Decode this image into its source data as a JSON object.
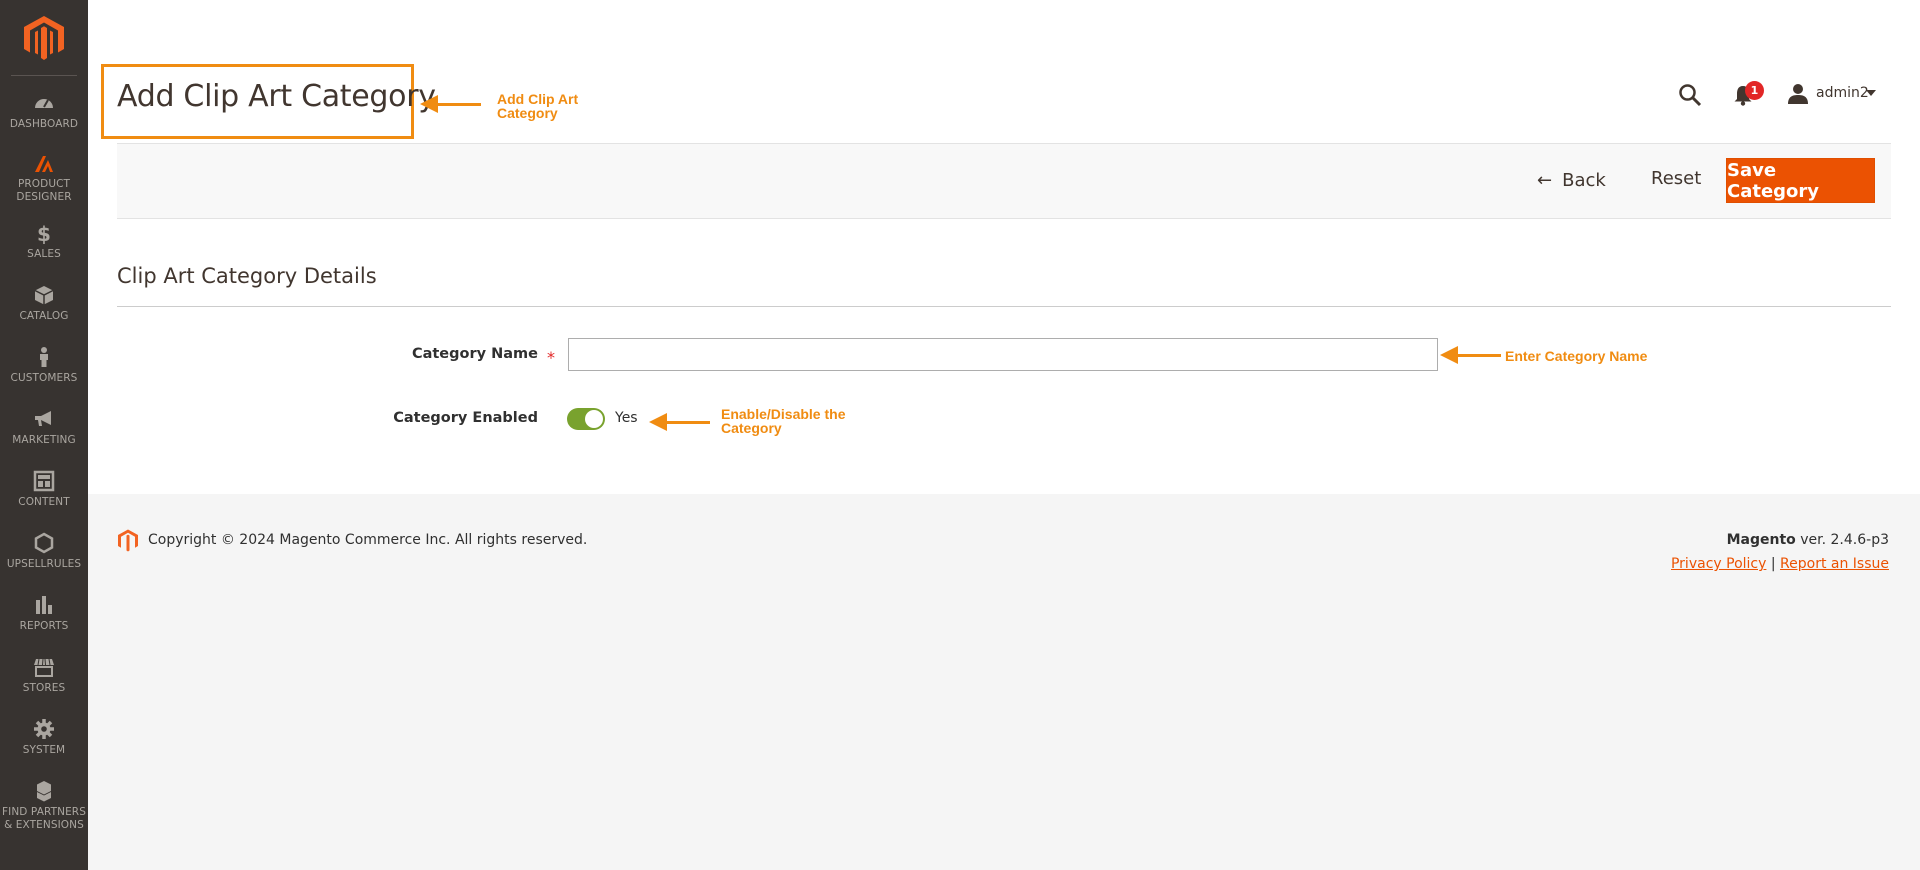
{
  "sidebar": {
    "logo": "magento-logo",
    "items": [
      {
        "label": "DASHBOARD",
        "icon": "dashboard-icon"
      },
      {
        "label": "PRODUCT DESIGNER",
        "icon": "product-designer-icon"
      },
      {
        "label": "SALES",
        "icon": "dollar-icon"
      },
      {
        "label": "CATALOG",
        "icon": "cube-icon"
      },
      {
        "label": "CUSTOMERS",
        "icon": "person-icon"
      },
      {
        "label": "MARKETING",
        "icon": "megaphone-icon"
      },
      {
        "label": "CONTENT",
        "icon": "layout-icon"
      },
      {
        "label": "UPSELLRULES",
        "icon": "hexagon-icon"
      },
      {
        "label": "REPORTS",
        "icon": "bar-chart-icon"
      },
      {
        "label": "STORES",
        "icon": "storefront-icon"
      },
      {
        "label": "SYSTEM",
        "icon": "gear-icon"
      },
      {
        "label": "FIND PARTNERS & EXTENSIONS",
        "icon": "boxes-icon"
      }
    ]
  },
  "header": {
    "title": "Add Clip Art Category",
    "notification_count": "1",
    "user_name": "admin2"
  },
  "annotations": {
    "title_note": "Add Clip Art Category",
    "name_note": "Enter Category Name",
    "enabled_note": "Enable/Disable the Category",
    "color": "#f08c12"
  },
  "actions": {
    "back_label": "Back",
    "reset_label": "Reset",
    "save_label": "Save Category",
    "accent": "#eb5202"
  },
  "form": {
    "section_title": "Clip Art Category Details",
    "category_name_label": "Category Name",
    "category_name_value": "",
    "category_enabled_label": "Category Enabled",
    "category_enabled_state": "Yes",
    "toggle_color": "#79a22e"
  },
  "footer": {
    "copyright": "Copyright © 2024 Magento Commerce Inc. All rights reserved.",
    "brand": "Magento",
    "version": "ver. 2.4.6-p3",
    "privacy_link": "Privacy Policy",
    "separator": "|",
    "report_link": "Report an Issue"
  }
}
